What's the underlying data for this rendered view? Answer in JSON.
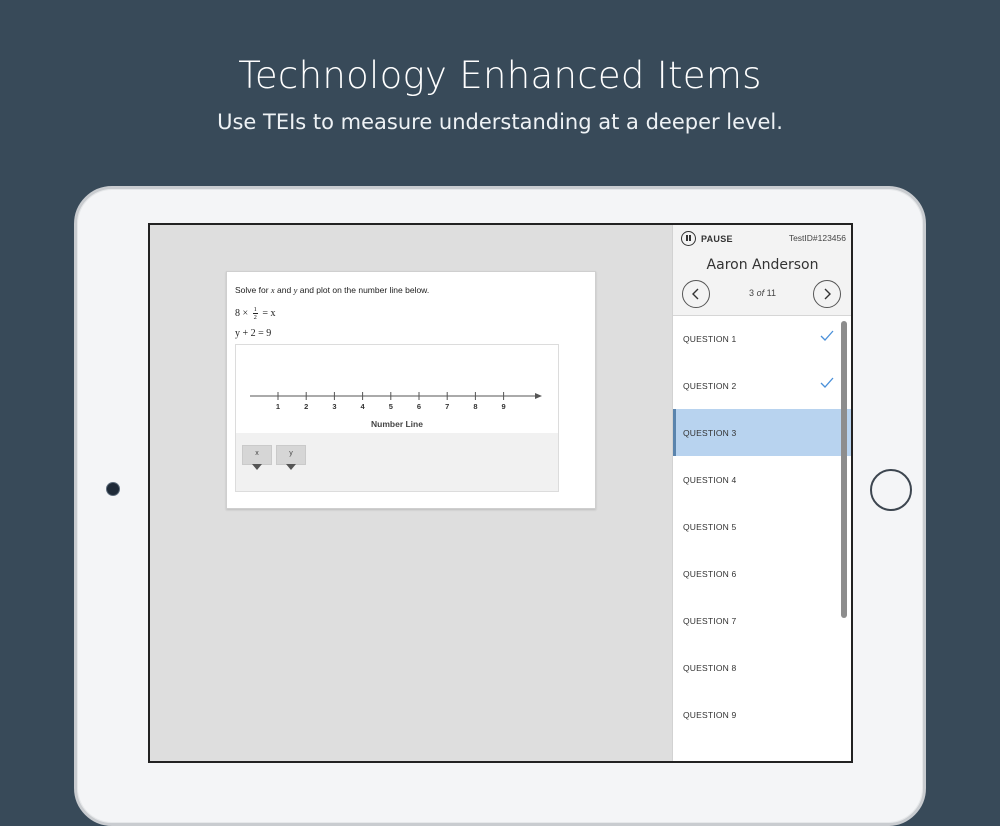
{
  "hero": {
    "title": "Technology Enhanced Items",
    "subtitle": "Use TEIs to measure understanding at a deeper level."
  },
  "question": {
    "prompt_pre": "Solve for ",
    "var_x": "x",
    "prompt_and": " and ",
    "var_y": "y",
    "prompt_post": " and plot on the number line below.",
    "eq1_left": "8 ×",
    "eq1_num": "1",
    "eq1_den": "2",
    "eq1_right": "= x",
    "eq2": "y + 2 = 9",
    "number_line": {
      "ticks": [
        "1",
        "2",
        "3",
        "4",
        "5",
        "6",
        "7",
        "8",
        "9"
      ],
      "caption": "Number Line"
    },
    "tokens": [
      "x",
      "y"
    ]
  },
  "sidebar": {
    "pause_label": "PAUSE",
    "test_id": "TestID#123456",
    "student_name": "Aaron Anderson",
    "progress_current": "3",
    "progress_of": "of",
    "progress_total": "11",
    "questions": [
      {
        "label": "QUESTION 1",
        "answered": true
      },
      {
        "label": "QUESTION 2",
        "answered": true
      },
      {
        "label": "QUESTION 3",
        "answered": false,
        "active": true
      },
      {
        "label": "QUESTION 4",
        "answered": false
      },
      {
        "label": "QUESTION 5",
        "answered": false
      },
      {
        "label": "QUESTION 6",
        "answered": false
      },
      {
        "label": "QUESTION 7",
        "answered": false
      },
      {
        "label": "QUESTION 8",
        "answered": false
      },
      {
        "label": "QUESTION 9",
        "answered": false
      }
    ]
  },
  "colors": {
    "background": "#384a59",
    "active_question": "#b8d3ef",
    "check": "#4a90d9"
  }
}
